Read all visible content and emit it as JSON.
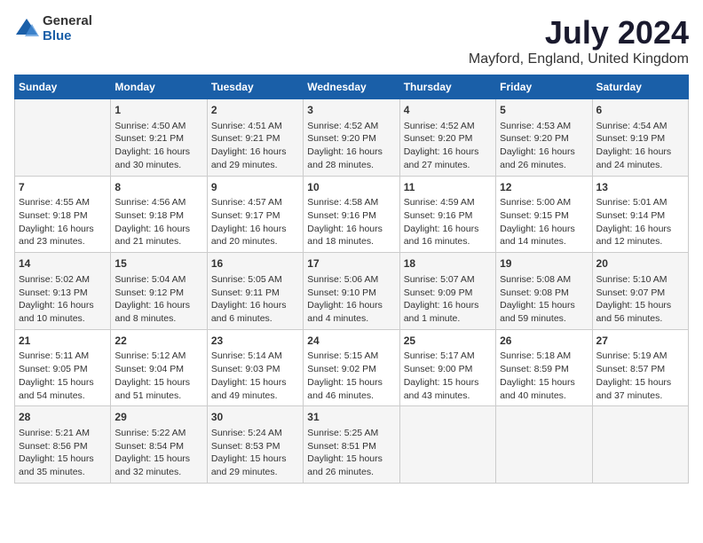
{
  "logo": {
    "general": "General",
    "blue": "Blue"
  },
  "title": "July 2024",
  "subtitle": "Mayford, England, United Kingdom",
  "days": [
    "Sunday",
    "Monday",
    "Tuesday",
    "Wednesday",
    "Thursday",
    "Friday",
    "Saturday"
  ],
  "weeks": [
    [
      {
        "day": "",
        "content": ""
      },
      {
        "day": "1",
        "content": "Sunrise: 4:50 AM\nSunset: 9:21 PM\nDaylight: 16 hours\nand 30 minutes."
      },
      {
        "day": "2",
        "content": "Sunrise: 4:51 AM\nSunset: 9:21 PM\nDaylight: 16 hours\nand 29 minutes."
      },
      {
        "day": "3",
        "content": "Sunrise: 4:52 AM\nSunset: 9:20 PM\nDaylight: 16 hours\nand 28 minutes."
      },
      {
        "day": "4",
        "content": "Sunrise: 4:52 AM\nSunset: 9:20 PM\nDaylight: 16 hours\nand 27 minutes."
      },
      {
        "day": "5",
        "content": "Sunrise: 4:53 AM\nSunset: 9:20 PM\nDaylight: 16 hours\nand 26 minutes."
      },
      {
        "day": "6",
        "content": "Sunrise: 4:54 AM\nSunset: 9:19 PM\nDaylight: 16 hours\nand 24 minutes."
      }
    ],
    [
      {
        "day": "7",
        "content": "Sunrise: 4:55 AM\nSunset: 9:18 PM\nDaylight: 16 hours\nand 23 minutes."
      },
      {
        "day": "8",
        "content": "Sunrise: 4:56 AM\nSunset: 9:18 PM\nDaylight: 16 hours\nand 21 minutes."
      },
      {
        "day": "9",
        "content": "Sunrise: 4:57 AM\nSunset: 9:17 PM\nDaylight: 16 hours\nand 20 minutes."
      },
      {
        "day": "10",
        "content": "Sunrise: 4:58 AM\nSunset: 9:16 PM\nDaylight: 16 hours\nand 18 minutes."
      },
      {
        "day": "11",
        "content": "Sunrise: 4:59 AM\nSunset: 9:16 PM\nDaylight: 16 hours\nand 16 minutes."
      },
      {
        "day": "12",
        "content": "Sunrise: 5:00 AM\nSunset: 9:15 PM\nDaylight: 16 hours\nand 14 minutes."
      },
      {
        "day": "13",
        "content": "Sunrise: 5:01 AM\nSunset: 9:14 PM\nDaylight: 16 hours\nand 12 minutes."
      }
    ],
    [
      {
        "day": "14",
        "content": "Sunrise: 5:02 AM\nSunset: 9:13 PM\nDaylight: 16 hours\nand 10 minutes."
      },
      {
        "day": "15",
        "content": "Sunrise: 5:04 AM\nSunset: 9:12 PM\nDaylight: 16 hours\nand 8 minutes."
      },
      {
        "day": "16",
        "content": "Sunrise: 5:05 AM\nSunset: 9:11 PM\nDaylight: 16 hours\nand 6 minutes."
      },
      {
        "day": "17",
        "content": "Sunrise: 5:06 AM\nSunset: 9:10 PM\nDaylight: 16 hours\nand 4 minutes."
      },
      {
        "day": "18",
        "content": "Sunrise: 5:07 AM\nSunset: 9:09 PM\nDaylight: 16 hours\nand 1 minute."
      },
      {
        "day": "19",
        "content": "Sunrise: 5:08 AM\nSunset: 9:08 PM\nDaylight: 15 hours\nand 59 minutes."
      },
      {
        "day": "20",
        "content": "Sunrise: 5:10 AM\nSunset: 9:07 PM\nDaylight: 15 hours\nand 56 minutes."
      }
    ],
    [
      {
        "day": "21",
        "content": "Sunrise: 5:11 AM\nSunset: 9:05 PM\nDaylight: 15 hours\nand 54 minutes."
      },
      {
        "day": "22",
        "content": "Sunrise: 5:12 AM\nSunset: 9:04 PM\nDaylight: 15 hours\nand 51 minutes."
      },
      {
        "day": "23",
        "content": "Sunrise: 5:14 AM\nSunset: 9:03 PM\nDaylight: 15 hours\nand 49 minutes."
      },
      {
        "day": "24",
        "content": "Sunrise: 5:15 AM\nSunset: 9:02 PM\nDaylight: 15 hours\nand 46 minutes."
      },
      {
        "day": "25",
        "content": "Sunrise: 5:17 AM\nSunset: 9:00 PM\nDaylight: 15 hours\nand 43 minutes."
      },
      {
        "day": "26",
        "content": "Sunrise: 5:18 AM\nSunset: 8:59 PM\nDaylight: 15 hours\nand 40 minutes."
      },
      {
        "day": "27",
        "content": "Sunrise: 5:19 AM\nSunset: 8:57 PM\nDaylight: 15 hours\nand 37 minutes."
      }
    ],
    [
      {
        "day": "28",
        "content": "Sunrise: 5:21 AM\nSunset: 8:56 PM\nDaylight: 15 hours\nand 35 minutes."
      },
      {
        "day": "29",
        "content": "Sunrise: 5:22 AM\nSunset: 8:54 PM\nDaylight: 15 hours\nand 32 minutes."
      },
      {
        "day": "30",
        "content": "Sunrise: 5:24 AM\nSunset: 8:53 PM\nDaylight: 15 hours\nand 29 minutes."
      },
      {
        "day": "31",
        "content": "Sunrise: 5:25 AM\nSunset: 8:51 PM\nDaylight: 15 hours\nand 26 minutes."
      },
      {
        "day": "",
        "content": ""
      },
      {
        "day": "",
        "content": ""
      },
      {
        "day": "",
        "content": ""
      }
    ]
  ]
}
